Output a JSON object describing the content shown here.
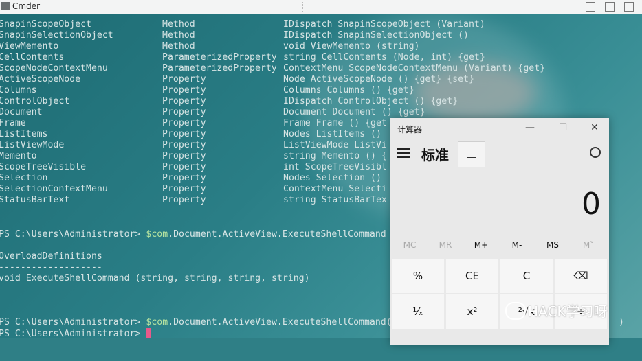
{
  "window": {
    "title": "Cmder"
  },
  "members": [
    {
      "name": "SnapinScopeObject",
      "type": "Method",
      "definition": "IDispatch SnapinScopeObject (Variant)"
    },
    {
      "name": "SnapinSelectionObject",
      "type": "Method",
      "definition": "IDispatch SnapinSelectionObject ()"
    },
    {
      "name": "ViewMemento",
      "type": "Method",
      "definition": "void ViewMemento (string)"
    },
    {
      "name": "CellContents",
      "type": "ParameterizedProperty",
      "definition": "string CellContents (Node, int) {get}"
    },
    {
      "name": "ScopeNodeContextMenu",
      "type": "ParameterizedProperty",
      "definition": "ContextMenu ScopeNodeContextMenu (Variant) {get}"
    },
    {
      "name": "ActiveScopeNode",
      "type": "Property",
      "definition": "Node ActiveScopeNode () {get} {set}"
    },
    {
      "name": "Columns",
      "type": "Property",
      "definition": "Columns Columns () {get}"
    },
    {
      "name": "ControlObject",
      "type": "Property",
      "definition": "IDispatch ControlObject () {get}"
    },
    {
      "name": "Document",
      "type": "Property",
      "definition": "Document Document () {get}"
    },
    {
      "name": "Frame",
      "type": "Property",
      "definition": "Frame Frame () {get"
    },
    {
      "name": "ListItems",
      "type": "Property",
      "definition": "Nodes ListItems ()"
    },
    {
      "name": "ListViewMode",
      "type": "Property",
      "definition": "ListViewMode ListVi"
    },
    {
      "name": "Memento",
      "type": "Property",
      "definition": "string Memento () {"
    },
    {
      "name": "ScopeTreeVisible",
      "type": "Property",
      "definition": "int ScopeTreeVisibl"
    },
    {
      "name": "Selection",
      "type": "Property",
      "definition": "Nodes Selection ()"
    },
    {
      "name": "SelectionContextMenu",
      "type": "Property",
      "definition": "ContextMenu Selecti"
    },
    {
      "name": "StatusBarText",
      "type": "Property",
      "definition": "string StatusBarTex"
    }
  ],
  "prompt1": {
    "prefix": "PS C:\\Users\\Administrator> ",
    "var": "$com",
    "rest": ".Document.ActiveView.ExecuteShellCommand"
  },
  "overload": {
    "header": "OverloadDefinitions",
    "rule": "-------------------",
    "signature": "void ExecuteShellCommand (string, string, string, string)"
  },
  "prompt2": {
    "prefix": "PS C:\\Users\\Administrator> ",
    "var": "$com",
    "rest": ".Document.ActiveView.ExecuteShellCommand("
  },
  "prompt2_tail": ")",
  "prompt3": {
    "prefix": "PS C:\\Users\\Administrator> "
  },
  "calculator": {
    "title": "计算器",
    "minimize": "—",
    "maximize": "☐",
    "close": "✕",
    "mode": "标准",
    "display": "0",
    "memory": [
      "MC",
      "MR",
      "M+",
      "M-",
      "MS",
      "M˅"
    ],
    "keys_row1": [
      "%",
      "CE",
      "C",
      "⌫"
    ],
    "keys_row2": [
      "¹⁄ₓ",
      "x²",
      "²√x",
      "÷"
    ]
  },
  "watermark": "HACK学习呀"
}
